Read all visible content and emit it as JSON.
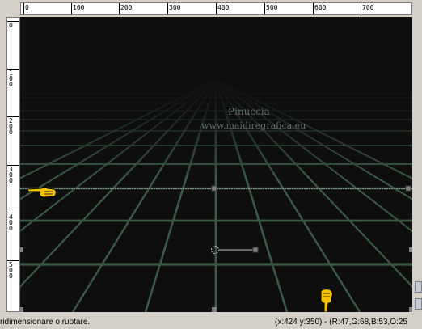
{
  "ruler": {
    "horizontal_labels": [
      "0",
      "100",
      "200",
      "300",
      "400",
      "500",
      "600",
      "700"
    ],
    "vertical_labels": [
      "0",
      "100",
      "200",
      "300",
      "400",
      "500"
    ]
  },
  "watermark": {
    "line1": "Pinuccia",
    "line2": "www.maidiregrafica.eu"
  },
  "status": {
    "hint": "ridimensionare o ruotare.",
    "readout": "(x:424 y:350) - (R:47,G:68,B:53,O:25"
  },
  "colors": {
    "canvas_bg": "#0e0e0e",
    "grid_line": "#3b5a46",
    "ui_face": "#d4d0c8",
    "pointer": "#f2c200"
  },
  "icons": [
    "pointing-hand-icon-left",
    "pointing-hand-icon-bottom",
    "rotation-pivot-icon"
  ]
}
